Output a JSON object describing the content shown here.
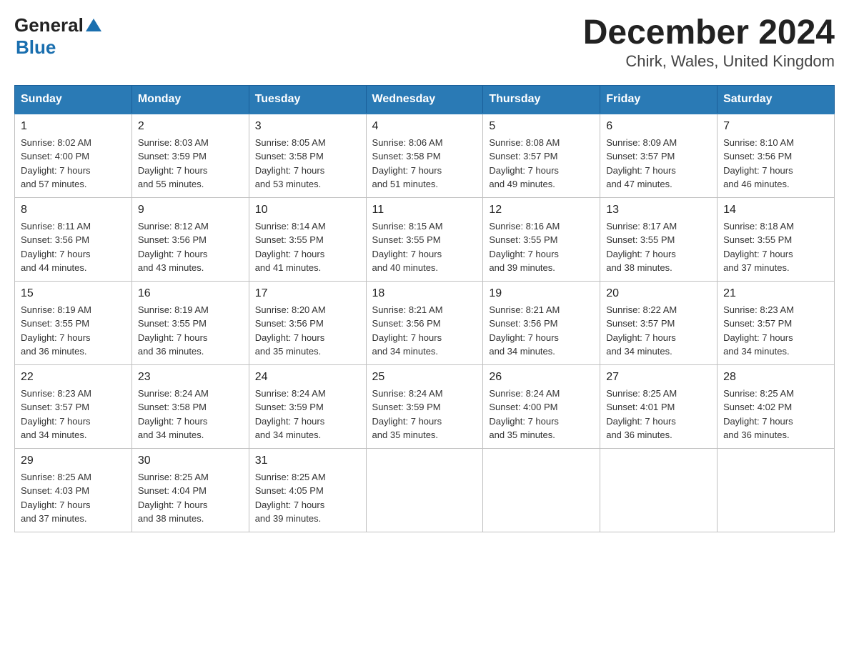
{
  "header": {
    "logo_general": "General",
    "logo_triangle": "▲",
    "logo_blue": "Blue",
    "title": "December 2024",
    "subtitle": "Chirk, Wales, United Kingdom"
  },
  "weekdays": [
    "Sunday",
    "Monday",
    "Tuesday",
    "Wednesday",
    "Thursday",
    "Friday",
    "Saturday"
  ],
  "weeks": [
    [
      {
        "day": "1",
        "sunrise": "8:02 AM",
        "sunset": "4:00 PM",
        "daylight": "7 hours and 57 minutes."
      },
      {
        "day": "2",
        "sunrise": "8:03 AM",
        "sunset": "3:59 PM",
        "daylight": "7 hours and 55 minutes."
      },
      {
        "day": "3",
        "sunrise": "8:05 AM",
        "sunset": "3:58 PM",
        "daylight": "7 hours and 53 minutes."
      },
      {
        "day": "4",
        "sunrise": "8:06 AM",
        "sunset": "3:58 PM",
        "daylight": "7 hours and 51 minutes."
      },
      {
        "day": "5",
        "sunrise": "8:08 AM",
        "sunset": "3:57 PM",
        "daylight": "7 hours and 49 minutes."
      },
      {
        "day": "6",
        "sunrise": "8:09 AM",
        "sunset": "3:57 PM",
        "daylight": "7 hours and 47 minutes."
      },
      {
        "day": "7",
        "sunrise": "8:10 AM",
        "sunset": "3:56 PM",
        "daylight": "7 hours and 46 minutes."
      }
    ],
    [
      {
        "day": "8",
        "sunrise": "8:11 AM",
        "sunset": "3:56 PM",
        "daylight": "7 hours and 44 minutes."
      },
      {
        "day": "9",
        "sunrise": "8:12 AM",
        "sunset": "3:56 PM",
        "daylight": "7 hours and 43 minutes."
      },
      {
        "day": "10",
        "sunrise": "8:14 AM",
        "sunset": "3:55 PM",
        "daylight": "7 hours and 41 minutes."
      },
      {
        "day": "11",
        "sunrise": "8:15 AM",
        "sunset": "3:55 PM",
        "daylight": "7 hours and 40 minutes."
      },
      {
        "day": "12",
        "sunrise": "8:16 AM",
        "sunset": "3:55 PM",
        "daylight": "7 hours and 39 minutes."
      },
      {
        "day": "13",
        "sunrise": "8:17 AM",
        "sunset": "3:55 PM",
        "daylight": "7 hours and 38 minutes."
      },
      {
        "day": "14",
        "sunrise": "8:18 AM",
        "sunset": "3:55 PM",
        "daylight": "7 hours and 37 minutes."
      }
    ],
    [
      {
        "day": "15",
        "sunrise": "8:19 AM",
        "sunset": "3:55 PM",
        "daylight": "7 hours and 36 minutes."
      },
      {
        "day": "16",
        "sunrise": "8:19 AM",
        "sunset": "3:55 PM",
        "daylight": "7 hours and 36 minutes."
      },
      {
        "day": "17",
        "sunrise": "8:20 AM",
        "sunset": "3:56 PM",
        "daylight": "7 hours and 35 minutes."
      },
      {
        "day": "18",
        "sunrise": "8:21 AM",
        "sunset": "3:56 PM",
        "daylight": "7 hours and 34 minutes."
      },
      {
        "day": "19",
        "sunrise": "8:21 AM",
        "sunset": "3:56 PM",
        "daylight": "7 hours and 34 minutes."
      },
      {
        "day": "20",
        "sunrise": "8:22 AM",
        "sunset": "3:57 PM",
        "daylight": "7 hours and 34 minutes."
      },
      {
        "day": "21",
        "sunrise": "8:23 AM",
        "sunset": "3:57 PM",
        "daylight": "7 hours and 34 minutes."
      }
    ],
    [
      {
        "day": "22",
        "sunrise": "8:23 AM",
        "sunset": "3:57 PM",
        "daylight": "7 hours and 34 minutes."
      },
      {
        "day": "23",
        "sunrise": "8:24 AM",
        "sunset": "3:58 PM",
        "daylight": "7 hours and 34 minutes."
      },
      {
        "day": "24",
        "sunrise": "8:24 AM",
        "sunset": "3:59 PM",
        "daylight": "7 hours and 34 minutes."
      },
      {
        "day": "25",
        "sunrise": "8:24 AM",
        "sunset": "3:59 PM",
        "daylight": "7 hours and 35 minutes."
      },
      {
        "day": "26",
        "sunrise": "8:24 AM",
        "sunset": "4:00 PM",
        "daylight": "7 hours and 35 minutes."
      },
      {
        "day": "27",
        "sunrise": "8:25 AM",
        "sunset": "4:01 PM",
        "daylight": "7 hours and 36 minutes."
      },
      {
        "day": "28",
        "sunrise": "8:25 AM",
        "sunset": "4:02 PM",
        "daylight": "7 hours and 36 minutes."
      }
    ],
    [
      {
        "day": "29",
        "sunrise": "8:25 AM",
        "sunset": "4:03 PM",
        "daylight": "7 hours and 37 minutes."
      },
      {
        "day": "30",
        "sunrise": "8:25 AM",
        "sunset": "4:04 PM",
        "daylight": "7 hours and 38 minutes."
      },
      {
        "day": "31",
        "sunrise": "8:25 AM",
        "sunset": "4:05 PM",
        "daylight": "7 hours and 39 minutes."
      },
      null,
      null,
      null,
      null
    ]
  ],
  "labels": {
    "sunrise": "Sunrise:",
    "sunset": "Sunset:",
    "daylight": "Daylight:"
  }
}
